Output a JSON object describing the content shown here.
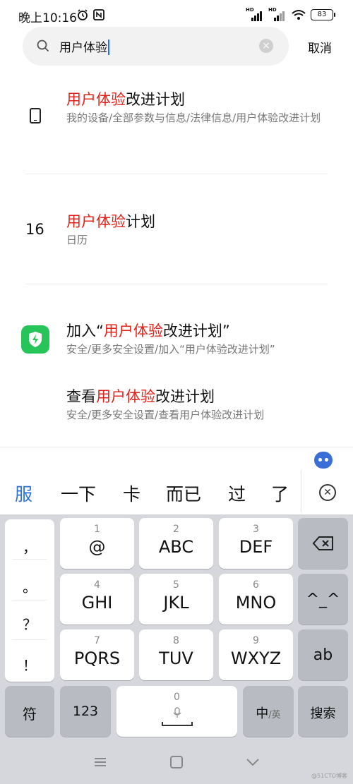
{
  "status_bar": {
    "time": "晚上10:16",
    "signal1": "HD",
    "signal2": "HD",
    "battery": "83"
  },
  "search": {
    "value": "用户体验",
    "clear_icon": "×",
    "cancel_label": "取消"
  },
  "results": [
    {
      "icon": "phone-icon",
      "title_hl": "用户体验",
      "title_rest": "改进计划",
      "subtitle": "我的设备/全部参数与信息/法律信息/用户体验改进计划"
    },
    {
      "icon_text": "16",
      "title_hl": "用户体验",
      "title_rest": "计划",
      "subtitle": "日历"
    },
    {
      "icon": "shield-icon",
      "title_pre": "加入“",
      "title_hl": "用户体验",
      "title_rest": "改进计划”",
      "subtitle": "安全/更多安全设置/加入“用户体验改进计划”"
    },
    {
      "title_pre": "查看",
      "title_hl": "用户体验",
      "title_rest": "改进计划",
      "subtitle": "安全/更多安全设置/查看用户体验改进计划"
    }
  ],
  "candidates": [
    "服",
    "一下",
    "卡",
    "而已",
    "过",
    "了"
  ],
  "keyboard": {
    "punctuation": [
      "，",
      "。",
      "？",
      "！"
    ],
    "rows": [
      [
        {
          "num": "1",
          "label": "@"
        },
        {
          "num": "2",
          "label": "ABC"
        },
        {
          "num": "3",
          "label": "DEF"
        }
      ],
      [
        {
          "num": "4",
          "label": "GHI"
        },
        {
          "num": "5",
          "label": "JKL"
        },
        {
          "num": "6",
          "label": "MNO"
        }
      ],
      [
        {
          "num": "7",
          "label": "PQRS"
        },
        {
          "num": "8",
          "label": "TUV"
        },
        {
          "num": "9",
          "label": "WXYZ"
        }
      ]
    ],
    "emoticon": "^_^",
    "abc": "ab",
    "symbol": "符",
    "num123": "123",
    "space_num": "0",
    "lang_main": "中",
    "lang_alt": "/英",
    "search_key": "搜索"
  },
  "colors": {
    "highlight": "#e0241c",
    "accent": "#2f72d6",
    "shield": "#27c45a"
  }
}
